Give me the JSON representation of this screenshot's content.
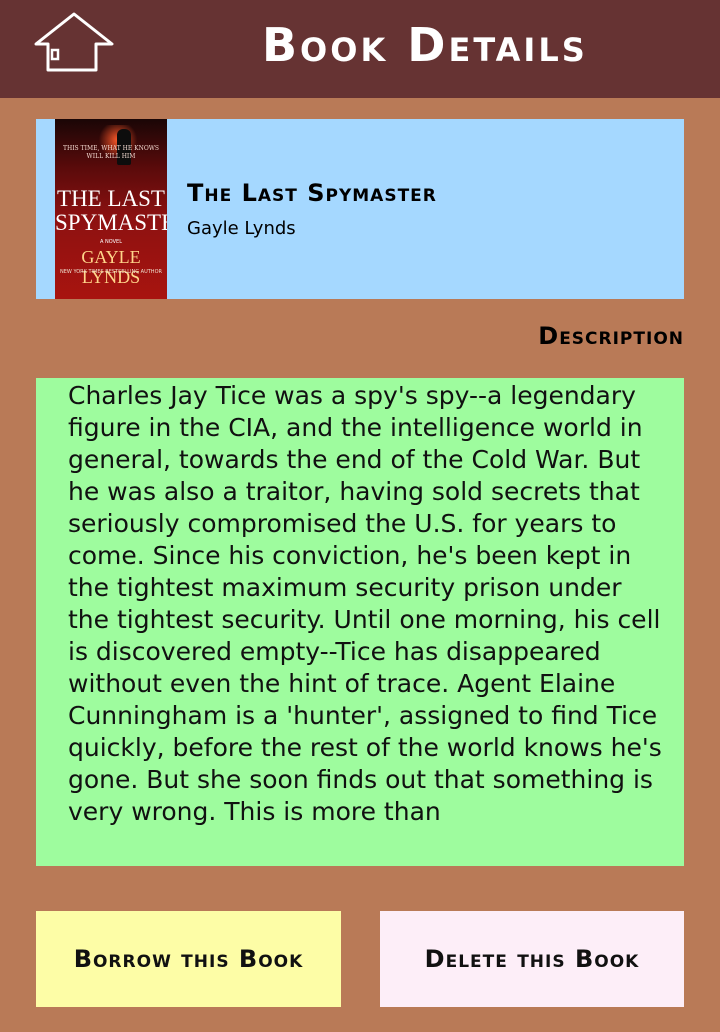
{
  "header": {
    "title": "Book Details",
    "home_icon": "home-icon"
  },
  "book": {
    "title": "The Last Spymaster",
    "author": "Gayle Lynds",
    "cover": {
      "tagline": "THIS TIME, WHAT HE KNOWS WILL KILL HIM",
      "title_line1": "THE LAST",
      "title_line2": "SPYMASTER",
      "novel_label": "A NOVEL",
      "author": "GAYLE LYNDS",
      "footer": "NEW YORK TIMES BESTSELLING AUTHOR"
    }
  },
  "description": {
    "label": "Description",
    "text": "Charles Jay Tice was a spy's spy--a legendary figure in the CIA, and the intelligence world in general, towards the end of the Cold War. But he was also a traitor, having sold secrets that seriously compromised the U.S. for years to come. Since his conviction, he's been kept in the tightest maximum security prison under the tightest security. Until one morning, his cell is discovered empty--Tice has disappeared without even the hint of trace. Agent Elaine Cunningham is a 'hunter', assigned to find Tice quickly, before the rest of the world knows he's gone. But she soon finds out that something is very wrong. This is more than"
  },
  "actions": {
    "borrow_label": "Borrow this Book",
    "delete_label": "Delete this Book"
  },
  "colors": {
    "header_bg": "#663333",
    "page_bg": "#b97a57",
    "book_card_bg": "#a5d8ff",
    "description_bg": "#9efc9e",
    "borrow_bg": "#fdfda6",
    "delete_bg": "#fdeef8"
  }
}
